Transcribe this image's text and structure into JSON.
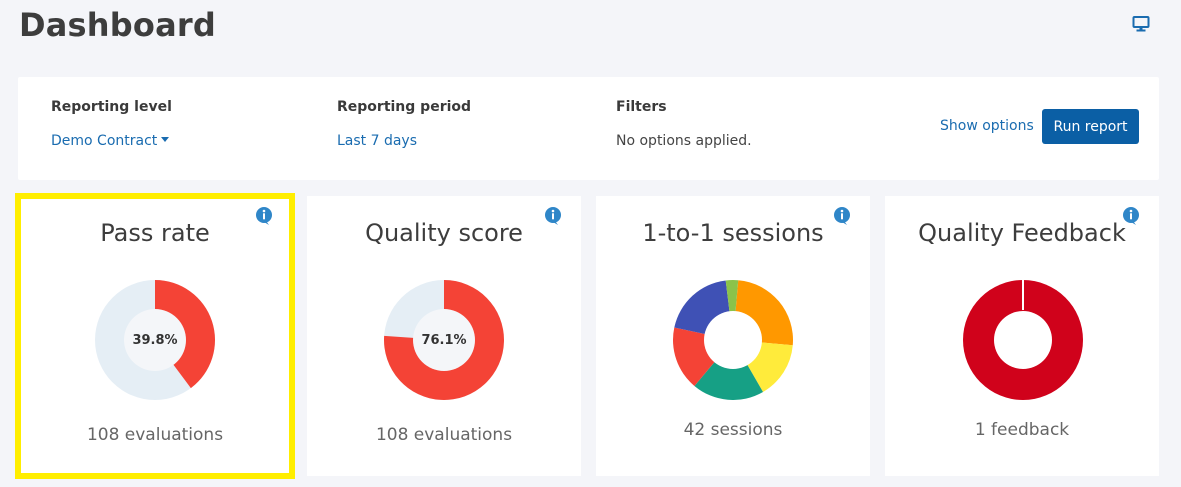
{
  "page": {
    "title": "Dashboard"
  },
  "colors": {
    "accent": "#1a6cb0",
    "button": "#0b5fa5",
    "highlight": "#ffee00",
    "donut_bg": "#e5eef5",
    "red": "#f44336",
    "dark_red": "#d0021b"
  },
  "icons": {
    "view_toggle": "monitor-icon",
    "info": "info-icon"
  },
  "report_bar": {
    "reporting_level": {
      "label": "Reporting level",
      "value": "Demo Contract"
    },
    "reporting_period": {
      "label": "Reporting period",
      "value": "Last 7 days"
    },
    "filters": {
      "label": "Filters",
      "value": "No options applied."
    },
    "show_options": "Show options",
    "run_report": "Run report"
  },
  "cards": [
    {
      "title": "Pass rate",
      "center": "39.8%",
      "footer": "108 evaluations",
      "percent": 39.8
    },
    {
      "title": "Quality score",
      "center": "76.1%",
      "footer": "108 evaluations",
      "percent": 76.1
    },
    {
      "title": "1-to-1 sessions",
      "footer": "42 sessions"
    },
    {
      "title": "Quality Feedback",
      "footer": "1 feedback"
    }
  ],
  "sessions_chart": {
    "segment_colors": [
      "#ff9800",
      "#ffeb3b",
      "#16a085",
      "#f44336",
      "#3f51b5",
      "#8bc34a"
    ]
  },
  "feedback_chart": {
    "color": "#d0021b"
  }
}
